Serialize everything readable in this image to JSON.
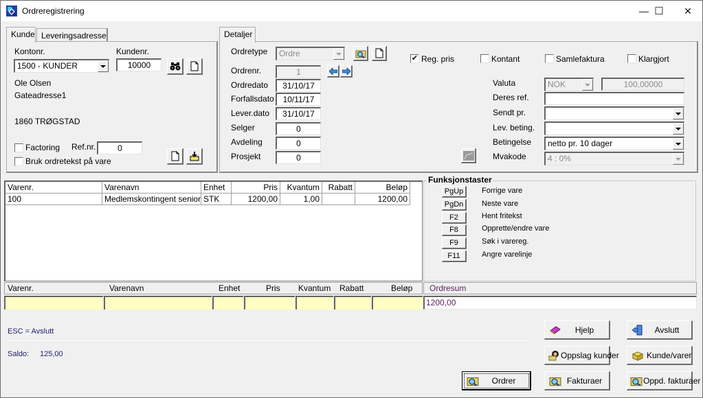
{
  "window": {
    "title": "Ordreregistrering",
    "controls": {
      "minimize": "—",
      "maximize": "☐",
      "close": "✕"
    }
  },
  "left_tabs": [
    {
      "label": "Kunde",
      "active": true
    },
    {
      "label": "Leveringsadresse",
      "active": false
    }
  ],
  "customer": {
    "kontonr_label": "Kontonr.",
    "kontonr_value": "1500 - KUNDER",
    "kundenr_label": "Kundenr.",
    "kundenr_value": "10000",
    "name": "Ole Olsen",
    "address1": "Gateadresse1",
    "postal": "1860 TRØGSTAD",
    "factoring_label": "Factoring",
    "factoring_checked": false,
    "refnr_label": "Ref.nr.",
    "refnr_value": "0",
    "ordretekst_label": "Bruk ordretekst på vare",
    "ordretekst_checked": false
  },
  "right_tabs": [
    {
      "label": "Detaljer",
      "active": true
    }
  ],
  "details": {
    "ordretype_label": "Ordretype",
    "ordretype_value": "Ordre",
    "ordrenr_label": "Ordrenr.",
    "ordrenr_value": "1",
    "ordredato_label": "Ordredato",
    "ordredato_value": "31/10/17",
    "forfallsdato_label": "Forfallsdato",
    "forfallsdato_value": "10/11/17",
    "leverdato_label": "Lever.dato",
    "leverdato_value": "31/10/17",
    "selger_label": "Selger",
    "selger_value": "0",
    "avdeling_label": "Avdeling",
    "avdeling_value": "0",
    "prosjekt_label": "Prosjekt",
    "prosjekt_value": "0",
    "checkboxes": [
      {
        "label": "Reg. pris",
        "checked": true,
        "mark": "✔"
      },
      {
        "label": "Kontant",
        "checked": false,
        "mark": ""
      },
      {
        "label": "Samlefaktura",
        "checked": false,
        "mark": ""
      },
      {
        "label": "Klargjort",
        "checked": false,
        "mark": ""
      }
    ],
    "valuta_label": "Valuta",
    "valuta_value": "NOK",
    "kurs_value": "100,00000",
    "deres_ref_label": "Deres ref.",
    "deres_ref_value": "",
    "sendt_pr_label": "Sendt pr.",
    "sendt_pr_value": "",
    "lev_beting_label": "Lev. beting.",
    "lev_beting_value": "",
    "betingelse_label": "Betingelse",
    "betingelse_value": "netto pr. 10 dager",
    "mvakode_label": "Mvakode",
    "mvakode_value": "4 : 0%"
  },
  "lines_grid": {
    "columns": [
      "Varenr.",
      "Varenavn",
      "Enhet",
      "Pris",
      "Kvantum",
      "Rabatt",
      "Beløp"
    ],
    "rows": [
      [
        "100",
        "Medlemskontingent senior",
        "STK",
        "1200,00",
        "1,00",
        "",
        "1200,00"
      ]
    ]
  },
  "function_keys": {
    "title": "Funksjonstaster",
    "keys": [
      {
        "key": "PgUp",
        "desc": "Forrige vare"
      },
      {
        "key": "PgDn",
        "desc": "Neste vare"
      },
      {
        "key": "F2",
        "desc": "Hent fritekst"
      },
      {
        "key": "F8",
        "desc": "Opprette/endre vare"
      },
      {
        "key": "F9",
        "desc": "Søk i varereg."
      },
      {
        "key": "F11",
        "desc": "Angre varelinje"
      }
    ]
  },
  "entry_row": {
    "columns": [
      "Varenr.",
      "Varenavn",
      "Enhet",
      "Pris",
      "Kvantum",
      "Rabatt",
      "Beløp"
    ],
    "ordresum_label": "Ordresum",
    "ordresum_value": "1200,00"
  },
  "footer": {
    "esc_hint": "ESC = Avslutt",
    "saldo_label": "Saldo:",
    "saldo_value": "125,00"
  },
  "buttons": {
    "hjelp": "Hjelp",
    "avslutt": "Avslutt",
    "oppslag_kunder": "Oppslag kunder",
    "kunde_varer": "Kunde/varer",
    "ordrer": "Ordrer",
    "fakturaer": "Fakturaer",
    "oppd_fakturaer": "Oppd. fakturaer"
  },
  "colors": {
    "entry_bg": "#ffffc4",
    "ordresum_text": "#5a1f5a",
    "footer_text": "#1e1e6e"
  }
}
